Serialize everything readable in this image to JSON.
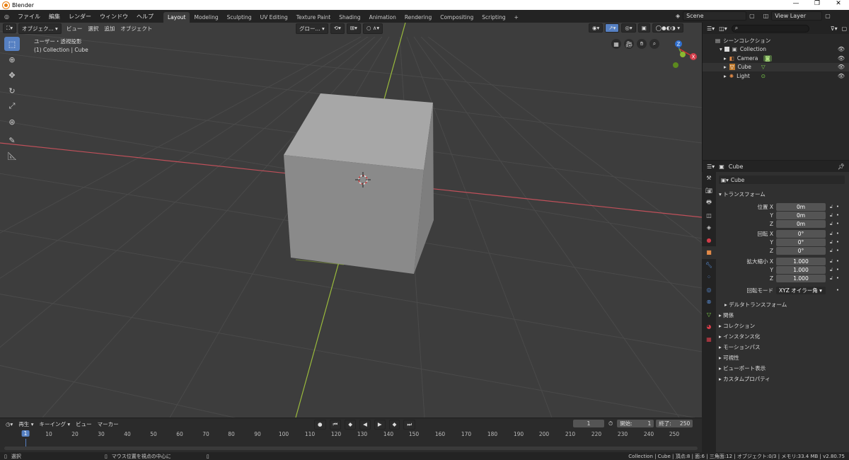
{
  "window": {
    "title": "Blender",
    "minimize": "—",
    "maximize": "❐",
    "close": "✕"
  },
  "menu": {
    "items": [
      "ファイル",
      "編集",
      "レンダー",
      "ウィンドウ",
      "ヘルプ"
    ]
  },
  "workspaces": [
    "Layout",
    "Modeling",
    "Sculpting",
    "UV Editing",
    "Texture Paint",
    "Shading",
    "Animation",
    "Rendering",
    "Compositing",
    "Scripting"
  ],
  "workspace_add": "+",
  "scene": {
    "label": "Scene",
    "view_layer": "View Layer"
  },
  "viewport": {
    "mode": "オブジェク...",
    "menus": [
      "ビュー",
      "選択",
      "追加",
      "オブジェクト"
    ],
    "transform_orientation": "グロー...",
    "view_name": "ユーザー・透視投影",
    "collection_info": "(1) Collection | Cube",
    "gizmo": {
      "z": "Z",
      "y": "Y",
      "x": "X"
    }
  },
  "outliner": {
    "search_placeholder": "",
    "root": "シーンコレクション",
    "items": [
      {
        "name": "Collection",
        "level": 1
      },
      {
        "name": "Camera",
        "level": 2
      },
      {
        "name": "Cube",
        "level": 2
      },
      {
        "name": "Light",
        "level": 2
      }
    ]
  },
  "properties": {
    "header_title": "Cube",
    "object_name": "Cube",
    "transform_section": "トランスフォーム",
    "location": {
      "label_x": "位置 X",
      "x": "0m",
      "y": "0m",
      "z": "0m"
    },
    "rotation": {
      "label_x": "回転 X",
      "x": "0°",
      "y": "0°",
      "z": "0°"
    },
    "scale": {
      "label_x": "拡大縮小 X",
      "x": "1.000",
      "y": "1.000",
      "z": "1.000"
    },
    "axis_y": "Y",
    "axis_z": "Z",
    "rotation_mode_label": "回転モード",
    "rotation_mode": "XYZ オイラー角",
    "delta_section": "デルタトランスフォーム",
    "sections": [
      "関係",
      "コレクション",
      "インスタンス化",
      "モーションパス",
      "可視性",
      "ビューポート表示",
      "カスタムプロパティ"
    ]
  },
  "timeline": {
    "menus": [
      "再生",
      "キーイング",
      "ビュー",
      "マーカー"
    ],
    "current_frame": "1",
    "start_label": "開始:",
    "start": "1",
    "end_label": "終了:",
    "end": "250",
    "ticks": [
      "1",
      "10",
      "20",
      "30",
      "40",
      "50",
      "60",
      "70",
      "80",
      "90",
      "100",
      "110",
      "120",
      "130",
      "140",
      "150",
      "160",
      "170",
      "180",
      "190",
      "200",
      "210",
      "220",
      "230",
      "240",
      "250"
    ]
  },
  "status": {
    "left": "選択",
    "middle": "マウス位置を視点の中心に",
    "right": "Collection | Cube | 頂点:8 | 面:6 | 三角面:12 | オブジェクト:0/3 | メモリ:33.4 MB | v2.80.75"
  },
  "colors": {
    "accent": "#5680c2",
    "x_axis": "#c0505a",
    "y_axis": "#9aba3c",
    "cube_front": "#8a8a8a",
    "cube_top": "#a7a7a7"
  }
}
